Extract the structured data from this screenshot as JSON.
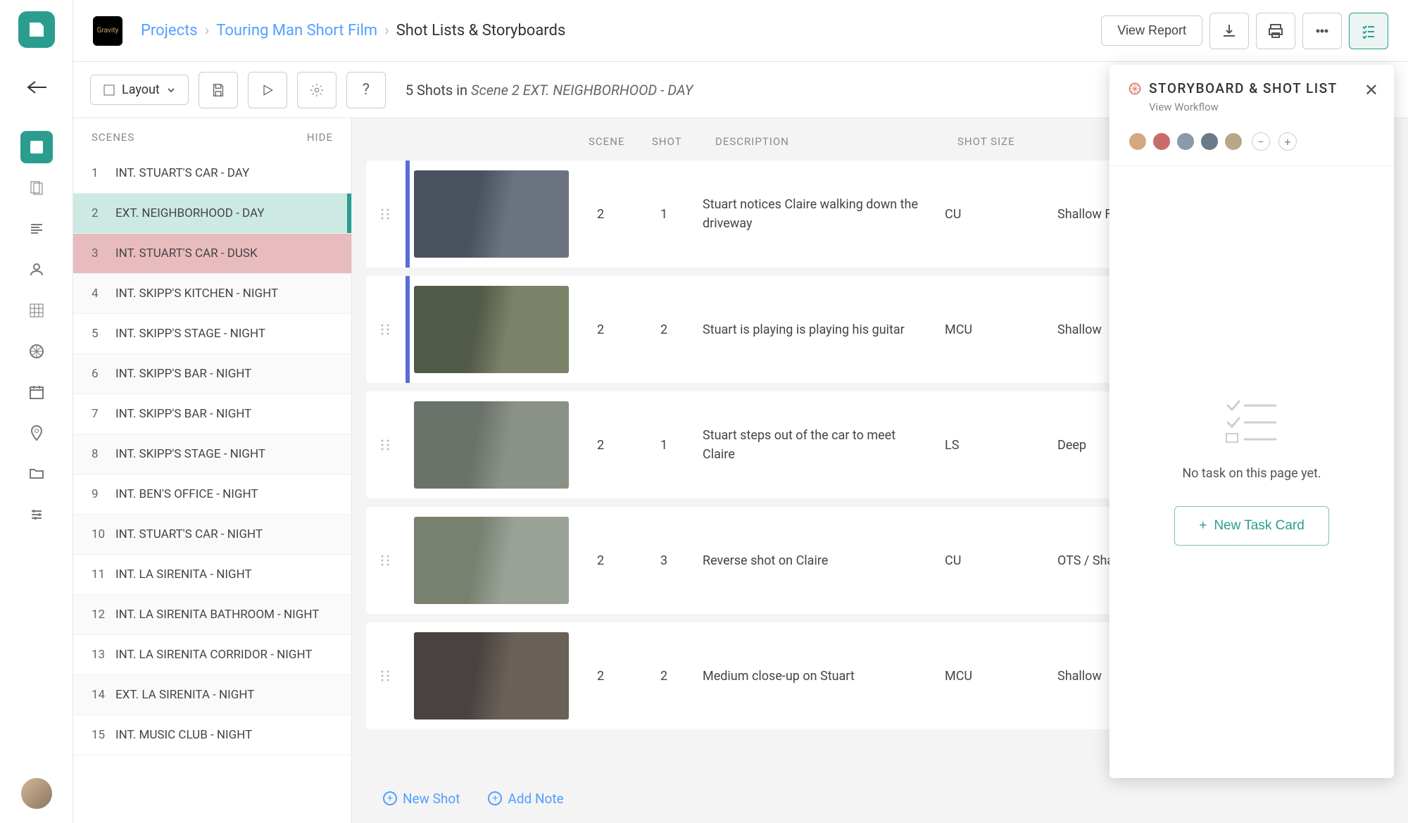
{
  "breadcrumb": {
    "projects": "Projects",
    "project_name": "Touring Man Short Film",
    "current": "Shot Lists & Storyboards"
  },
  "header": {
    "view_report": "View Report"
  },
  "project_badge": "Gravity",
  "toolbar": {
    "layout": "Layout",
    "shots_count": "5",
    "shots_in": "Shots in",
    "scene_label": "Scene 2 EXT. NEIGHBORHOOD - DAY"
  },
  "scenes_panel": {
    "header": "SCENES",
    "hide": "HIDE",
    "items": [
      {
        "num": "1",
        "name": "INT. STUART'S CAR - DAY"
      },
      {
        "num": "2",
        "name": "EXT. NEIGHBORHOOD - DAY"
      },
      {
        "num": "3",
        "name": "INT. STUART'S CAR - DUSK"
      },
      {
        "num": "4",
        "name": "INT. SKIPP'S KITCHEN - NIGHT"
      },
      {
        "num": "5",
        "name": "INT. SKIPP'S STAGE - NIGHT"
      },
      {
        "num": "6",
        "name": "INT. SKIPP'S BAR - NIGHT"
      },
      {
        "num": "7",
        "name": "INT. SKIPP'S BAR - NIGHT"
      },
      {
        "num": "8",
        "name": "INT. SKIPP'S STAGE - NIGHT"
      },
      {
        "num": "9",
        "name": "INT. BEN'S OFFICE - NIGHT"
      },
      {
        "num": "10",
        "name": "INT. STUART'S CAR - NIGHT"
      },
      {
        "num": "11",
        "name": "INT. LA SIRENITA - NIGHT"
      },
      {
        "num": "12",
        "name": "INT. LA SIRENITA BATHROOM - NIGHT"
      },
      {
        "num": "13",
        "name": "INT. LA SIRENITA CORRIDOR - NIGHT"
      },
      {
        "num": "14",
        "name": "EXT. LA SIRENITA - NIGHT"
      },
      {
        "num": "15",
        "name": "INT. MUSIC CLUB - NIGHT"
      }
    ]
  },
  "shot_headers": {
    "scene": "SCENE",
    "shot": "SHOT",
    "description": "DESCRIPTION",
    "shot_size": "SHOT SIZE"
  },
  "shots": [
    {
      "scene": "2",
      "shot": "1",
      "description": "Stuart notices Claire walking down the driveway",
      "size": "CU",
      "type": "Shallow Focus",
      "accent": true
    },
    {
      "scene": "2",
      "shot": "2",
      "description": "Stuart is playing is playing his guitar",
      "size": "MCU",
      "type": "Shallow",
      "accent": true
    },
    {
      "scene": "2",
      "shot": "1",
      "description": "Stuart steps out of the car to meet Claire",
      "size": "LS",
      "type": "Deep",
      "accent": false
    },
    {
      "scene": "2",
      "shot": "3",
      "description": "Reverse shot on Claire",
      "size": "CU",
      "type": "OTS / Shallow",
      "accent": false
    },
    {
      "scene": "2",
      "shot": "2",
      "description": "Medium close-up on Stuart",
      "size": "MCU",
      "type": "Shallow",
      "accent": false
    }
  ],
  "bottom": {
    "new_shot": "New Shot",
    "add_note": "Add Note"
  },
  "side_panel": {
    "title": "STORYBOARD & SHOT LIST",
    "subtitle": "View Workflow",
    "empty_text": "No task on this page yet.",
    "new_task": "New Task Card"
  }
}
